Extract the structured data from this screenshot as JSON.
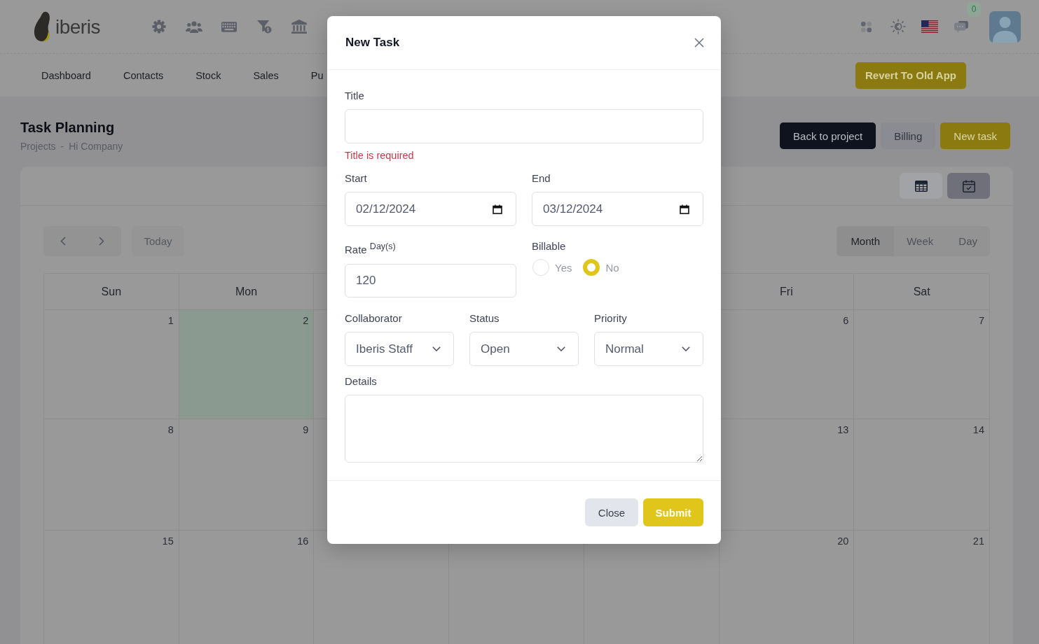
{
  "header": {
    "logo": "iberis",
    "notifications": "0"
  },
  "nav": {
    "items": [
      {
        "label": "Dashboard"
      },
      {
        "label": "Contacts"
      },
      {
        "label": "Stock"
      },
      {
        "label": "Sales"
      },
      {
        "label": "Pu"
      }
    ],
    "revert_button": "Revert To Old App"
  },
  "page": {
    "title": "Task Planning",
    "breadcrumb": {
      "items": [
        "Projects",
        "Hi Company"
      ],
      "separator": "-"
    },
    "actions": [
      {
        "label": "Back to project",
        "kind": "dark"
      },
      {
        "label": "Billing",
        "kind": "light"
      },
      {
        "label": "New task",
        "kind": "primary"
      }
    ]
  },
  "calendar": {
    "view_toggle": [
      {
        "kind": "table",
        "selected": false
      },
      {
        "kind": "calendar",
        "selected": true
      }
    ],
    "today_button": "Today",
    "views": [
      {
        "label": "Month",
        "selected": true
      },
      {
        "label": "Week",
        "selected": false
      },
      {
        "label": "Day",
        "selected": false
      }
    ],
    "weekdays": [
      "Sun",
      "Mon",
      "Fri",
      "Sat"
    ],
    "weeks": [
      {
        "days": [
          {
            "label": "1",
            "today": false
          },
          {
            "label": "2",
            "today": true
          },
          {
            "label": "6",
            "today": false
          },
          {
            "label": "7",
            "today": false
          }
        ]
      },
      {
        "days": [
          {
            "label": "8",
            "today": false
          },
          {
            "label": "9",
            "today": false
          },
          {
            "label": "13",
            "today": false
          },
          {
            "label": "14",
            "today": false
          }
        ]
      },
      {
        "days": [
          {
            "label": "15",
            "today": false
          },
          {
            "label": "16",
            "today": false
          },
          {
            "label": "20",
            "today": false
          },
          {
            "label": "21",
            "today": false
          }
        ]
      }
    ]
  },
  "modal": {
    "title": "New Task",
    "title_field": {
      "label": "Title",
      "error": "Title is required"
    },
    "dates": [
      {
        "label": "Start",
        "value": "02/12/2024"
      },
      {
        "label": "End",
        "value": "03/12/2024"
      }
    ],
    "rate": {
      "label": "Rate $^{Day(s)}$",
      "value": "120"
    },
    "billable": {
      "label": "Billable",
      "options": [
        {
          "label": "Yes",
          "selected": false
        },
        {
          "label": "No",
          "selected": true
        }
      ]
    },
    "selects": [
      {
        "label": "Collaborator",
        "value": "Iberis Staff"
      },
      {
        "label": "Status",
        "value": "Open"
      },
      {
        "label": "Priority",
        "value": "Normal"
      }
    ],
    "details": {
      "label": "Details"
    },
    "buttons": [
      {
        "label": "Close",
        "kind": "secondary"
      },
      {
        "label": "Submit",
        "kind": "primary"
      }
    ]
  }
}
